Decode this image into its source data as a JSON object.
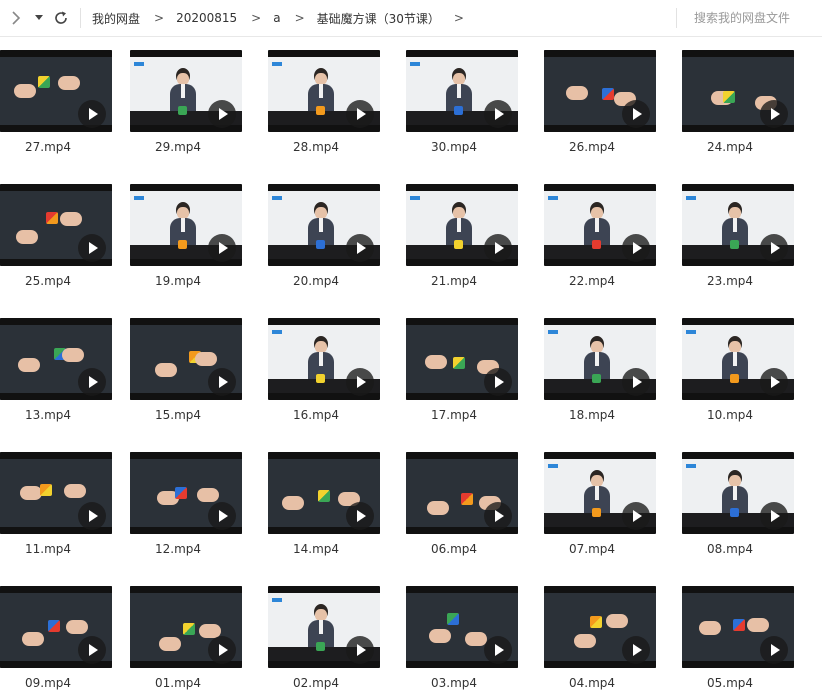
{
  "toolbar": {
    "back_icon": "chevron-right-icon",
    "dropdown_icon": "caret-down-icon",
    "refresh_icon": "refresh-icon"
  },
  "breadcrumb": {
    "items": [
      "我的网盘",
      "20200815",
      "a",
      "基础魔方课（30节课）"
    ],
    "separator": ">"
  },
  "search": {
    "placeholder": "搜索我的网盘文件"
  },
  "files": [
    {
      "name": "27.mp4",
      "scene": "hands-dark"
    },
    {
      "name": "29.mp4",
      "scene": "presenter-light"
    },
    {
      "name": "28.mp4",
      "scene": "presenter-light"
    },
    {
      "name": "30.mp4",
      "scene": "presenter-light"
    },
    {
      "name": "26.mp4",
      "scene": "hands-dark"
    },
    {
      "name": "24.mp4",
      "scene": "hands-dark"
    },
    {
      "name": "25.mp4",
      "scene": "hands-dark"
    },
    {
      "name": "19.mp4",
      "scene": "presenter-light"
    },
    {
      "name": "20.mp4",
      "scene": "presenter-light"
    },
    {
      "name": "21.mp4",
      "scene": "presenter-light"
    },
    {
      "name": "22.mp4",
      "scene": "presenter-light"
    },
    {
      "name": "23.mp4",
      "scene": "presenter-light"
    },
    {
      "name": "13.mp4",
      "scene": "hands-dark"
    },
    {
      "name": "15.mp4",
      "scene": "hands-dark"
    },
    {
      "name": "16.mp4",
      "scene": "presenter-light"
    },
    {
      "name": "17.mp4",
      "scene": "hands-dark"
    },
    {
      "name": "18.mp4",
      "scene": "presenter-light"
    },
    {
      "name": "10.mp4",
      "scene": "presenter-light"
    },
    {
      "name": "11.mp4",
      "scene": "hands-dark"
    },
    {
      "name": "12.mp4",
      "scene": "hands-dark"
    },
    {
      "name": "14.mp4",
      "scene": "hands-dark"
    },
    {
      "name": "06.mp4",
      "scene": "hands-dark"
    },
    {
      "name": "07.mp4",
      "scene": "presenter-light"
    },
    {
      "name": "08.mp4",
      "scene": "presenter-light"
    },
    {
      "name": "09.mp4",
      "scene": "hands-dark"
    },
    {
      "name": "01.mp4",
      "scene": "hands-dark"
    },
    {
      "name": "02.mp4",
      "scene": "presenter-light"
    },
    {
      "name": "03.mp4",
      "scene": "hands-dark"
    },
    {
      "name": "04.mp4",
      "scene": "hands-dark"
    },
    {
      "name": "05.mp4",
      "scene": "hands-dark"
    }
  ],
  "colors": {
    "dark_bg": "#2b3138",
    "light_bg": "#eef0f2",
    "accent_blue": "#2d86d8",
    "cube_colors": [
      "#f2d22e",
      "#e53b2f",
      "#3aa655",
      "#f39a1d",
      "#2c6fd6",
      "#ffffff"
    ]
  }
}
